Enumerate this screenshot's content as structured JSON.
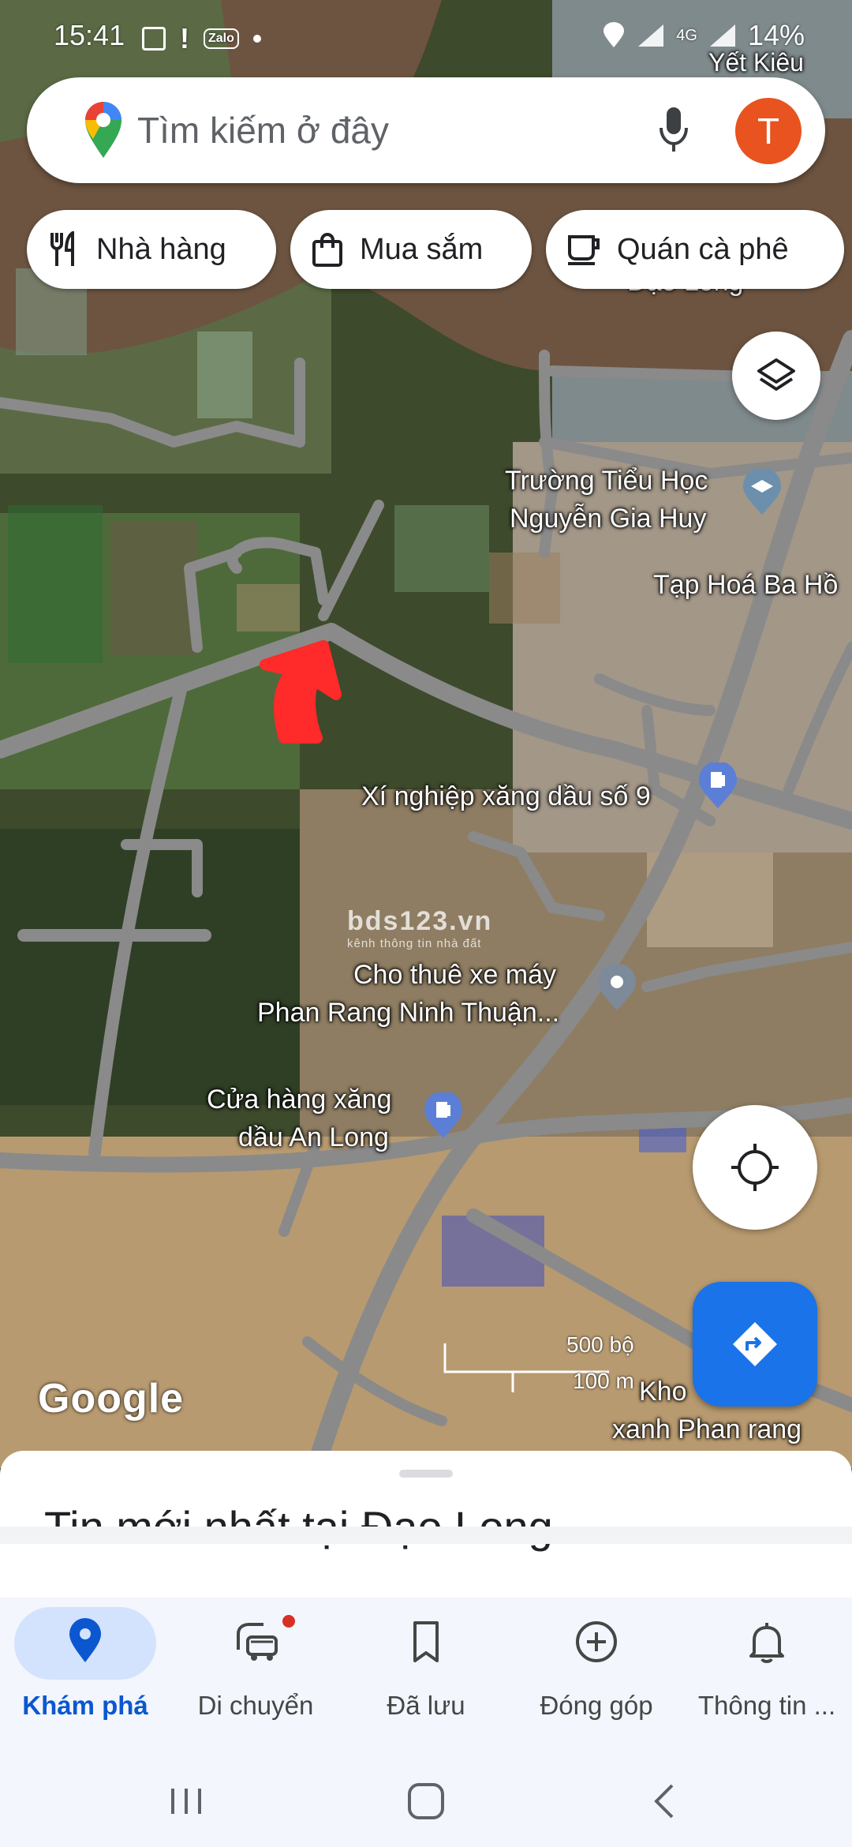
{
  "status_bar": {
    "time": "15:41",
    "zalo_label": "Zalo",
    "network": "4G",
    "battery": "14%",
    "left_icons": [
      "image-icon",
      "alert-icon",
      "zalo-icon",
      "dot-icon"
    ],
    "right_icons": [
      "location-icon",
      "signal-icon",
      "signal-icon",
      "battery-icon"
    ]
  },
  "search": {
    "placeholder": "Tìm kiếm ở đây",
    "avatar_letter": "T",
    "avatar_color": "#e8531f"
  },
  "chips": [
    {
      "label": "Nhà hàng",
      "icon": "restaurant-icon"
    },
    {
      "label": "Mua sắm",
      "icon": "shopping-bag-icon"
    },
    {
      "label": "Quán cà phê",
      "icon": "coffee-icon"
    }
  ],
  "map": {
    "labels": {
      "yet_kieu": "Yết Kiêu",
      "dao_long": "Đạo Long",
      "school_line1": "Trường Tiểu Học",
      "school_line2": "Nguyễn Gia Huy",
      "grocery": "Tạp Hoá Ba Hồ",
      "gas9": "Xí nghiệp xăng dầu số 9",
      "rental_line1": "Cho thuê xe máy",
      "rental_line2": "Phan Rang Ninh Thuận...",
      "anlong_line1": "Cửa hàng xăng",
      "anlong_line2": "dầu An Long",
      "kho_line1": "Kho",
      "kho_line2": "xanh Phan rang"
    },
    "watermark": "bds123.vn",
    "watermark_sub": "kênh thông tin nhà đất",
    "google_logo": "Google",
    "scale_imperial": "500 bộ",
    "scale_metric": "100 m"
  },
  "sheet": {
    "title": "Tin mới nhất tại Đạo Long"
  },
  "nav": {
    "items": [
      {
        "label": "Khám phá",
        "icon": "explore-pin-icon",
        "active": true
      },
      {
        "label": "Di chuyển",
        "icon": "commute-icon",
        "active": false
      },
      {
        "label": "Đã lưu",
        "icon": "bookmark-icon",
        "active": false
      },
      {
        "label": "Đóng góp",
        "icon": "add-circle-icon",
        "active": false
      },
      {
        "label": "Thông tin ...",
        "icon": "bell-icon",
        "active": false
      }
    ]
  },
  "colors": {
    "accent_blue": "#1a73e8",
    "nav_active": "#0b57d0",
    "nav_pill": "#d3e3fd",
    "arrow_red": "#ff2a2a"
  }
}
